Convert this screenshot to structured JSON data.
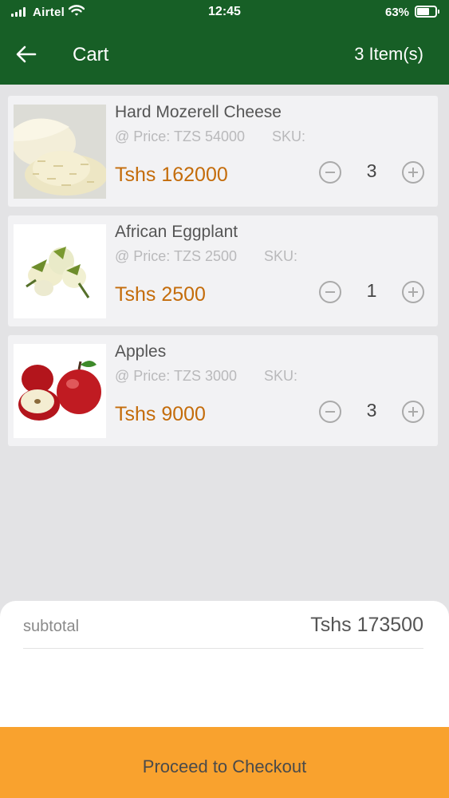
{
  "status_bar": {
    "carrier": "Airtel",
    "time": "12:45",
    "battery_percent": "63%",
    "battery_level": 0.63,
    "icons": [
      "signal-icon",
      "wifi-icon",
      "battery-icon"
    ]
  },
  "header": {
    "title": "Cart",
    "item_count": "3 Item(s)",
    "back_icon": "arrow-left-icon",
    "background_color": "#175f26"
  },
  "cart": {
    "items": [
      {
        "name": "Hard Mozerell Cheese",
        "unit_price": "@ Price: TZS 54000",
        "sku_label": "SKU:",
        "line_total": "Tshs 162000",
        "quantity": "3"
      },
      {
        "name": "African Eggplant",
        "unit_price": "@ Price: TZS 2500",
        "sku_label": "SKU:",
        "line_total": "Tshs 2500",
        "quantity": "1"
      },
      {
        "name": "Apples",
        "unit_price": "@ Price: TZS 3000",
        "sku_label": "SKU:",
        "line_total": "Tshs 9000",
        "quantity": "3"
      }
    ],
    "price_color": "#c46c0a"
  },
  "summary": {
    "subtotal_label": "subtotal",
    "subtotal_value": "Tshs 173500"
  },
  "checkout": {
    "label": "Proceed to Checkout",
    "color": "#f9a22e"
  }
}
